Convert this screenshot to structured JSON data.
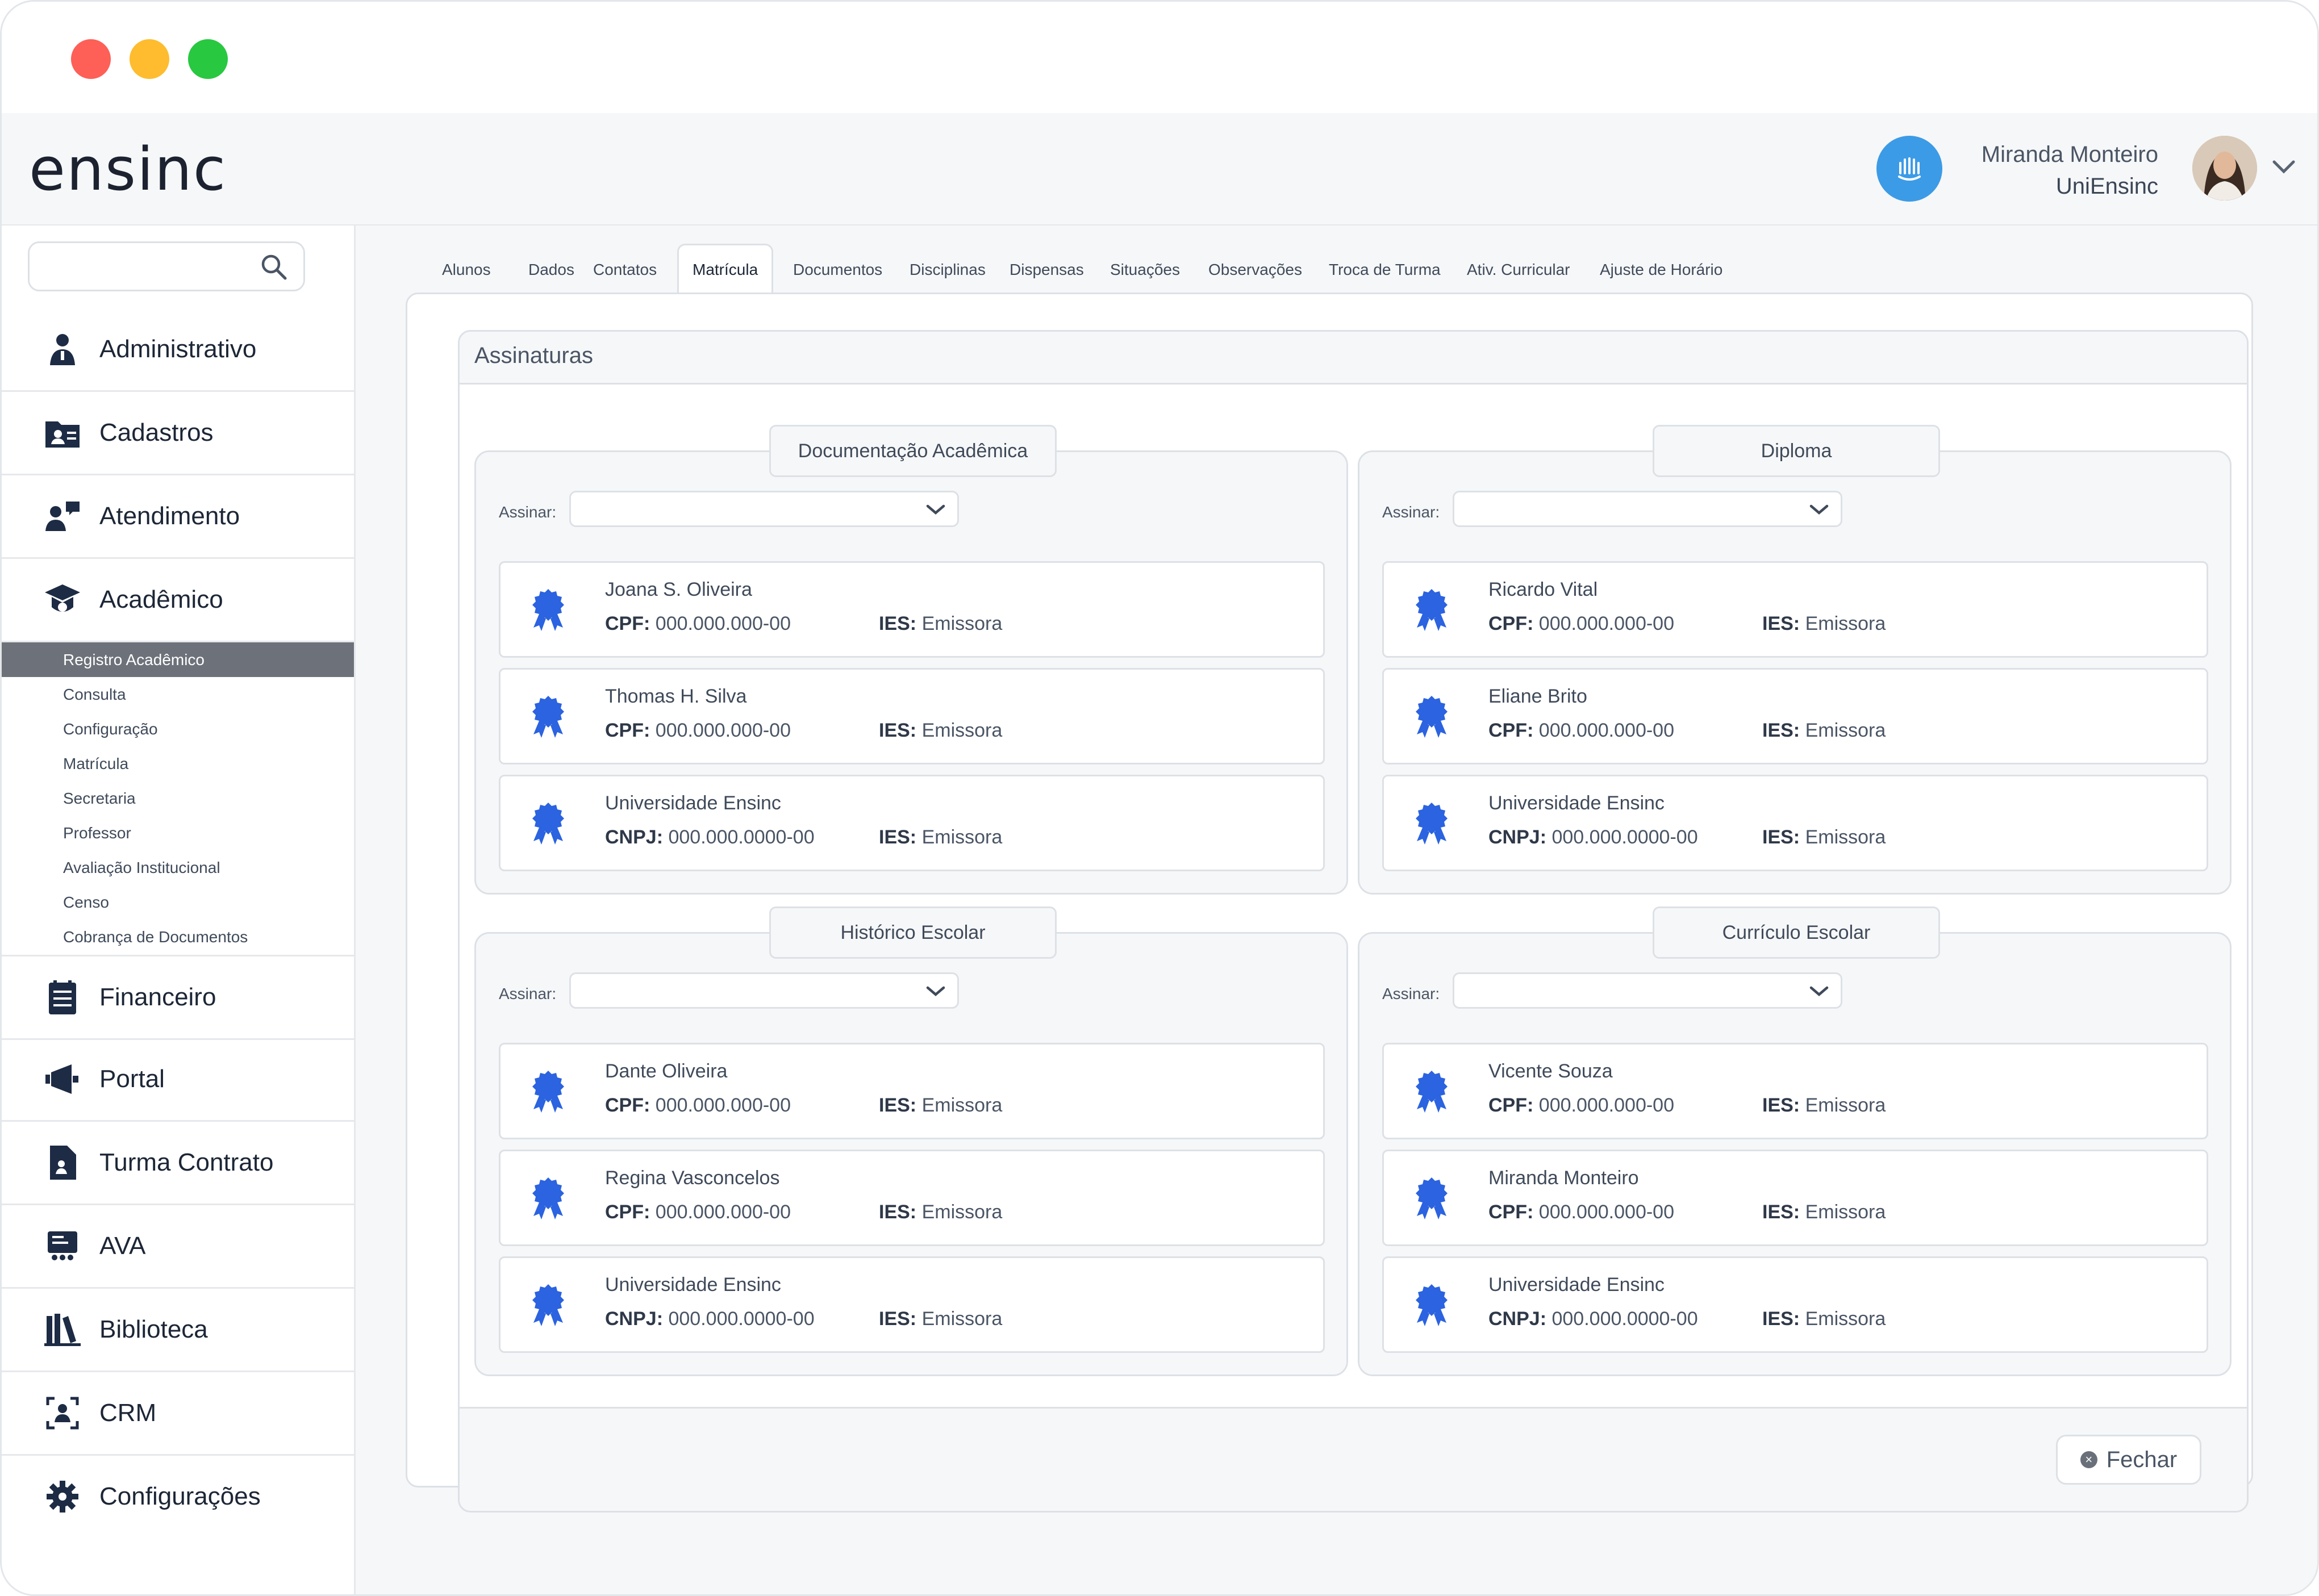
{
  "app": {
    "logo": "ensinc"
  },
  "user": {
    "name": "Miranda Monteiro",
    "org": "UniEnsinc"
  },
  "search": {
    "placeholder": ""
  },
  "sidebar": {
    "items": [
      {
        "label": "Administrativo",
        "icon": "person-badge-icon"
      },
      {
        "label": "Cadastros",
        "icon": "id-folder-icon"
      },
      {
        "label": "Atendimento",
        "icon": "people-chat-icon"
      },
      {
        "label": "Acadêmico",
        "icon": "graduation-cap-icon"
      },
      {
        "label": "Financeiro",
        "icon": "ledger-icon"
      },
      {
        "label": "Portal",
        "icon": "megaphone-icon"
      },
      {
        "label": "Turma Contrato",
        "icon": "contract-file-icon"
      },
      {
        "label": "AVA",
        "icon": "monitor-class-icon"
      },
      {
        "label": "Biblioteca",
        "icon": "books-icon"
      },
      {
        "label": "CRM",
        "icon": "crm-person-icon"
      },
      {
        "label": "Configurações",
        "icon": "gear-icon"
      }
    ],
    "submenu": [
      "Registro Acadêmico",
      "Consulta",
      "Configuração",
      "Matrícula",
      "Secretaria",
      "Professor",
      "Avaliação Institucional",
      "Censo",
      "Cobrança de Documentos"
    ]
  },
  "tabs": [
    "Alunos",
    "Dados",
    "Contatos",
    "Matrícula",
    "Documentos",
    "Disciplinas",
    "Dispensas",
    "Situações",
    "Observações",
    "Troca de Turma",
    "Ativ. Curricular",
    "Ajuste de Horário"
  ],
  "modal": {
    "title": "Assinaturas",
    "close_label": "Fechar",
    "assinar_label": "Assinar:",
    "labels": {
      "cpf": "CPF:",
      "cnpj": "CNPJ:",
      "ies": "IES:"
    },
    "groups": [
      {
        "title": "Documentação Acadêmica",
        "signers": [
          {
            "name": "Joana S. Oliveira",
            "doc_type": "CPF:",
            "doc": "000.000.000-00",
            "ies": "Emissora"
          },
          {
            "name": "Thomas H. Silva",
            "doc_type": "CPF:",
            "doc": "000.000.000-00",
            "ies": "Emissora"
          },
          {
            "name": "Universidade Ensinc",
            "doc_type": "CNPJ:",
            "doc": "000.000.0000-00",
            "ies": "Emissora"
          }
        ]
      },
      {
        "title": "Diploma",
        "signers": [
          {
            "name": "Ricardo Vital",
            "doc_type": "CPF:",
            "doc": "000.000.000-00",
            "ies": "Emissora"
          },
          {
            "name": "Eliane Brito",
            "doc_type": "CPF:",
            "doc": "000.000.000-00",
            "ies": "Emissora"
          },
          {
            "name": "Universidade Ensinc",
            "doc_type": "CNPJ:",
            "doc": "000.000.0000-00",
            "ies": "Emissora"
          }
        ]
      },
      {
        "title": "Histórico Escolar",
        "signers": [
          {
            "name": "Dante Oliveira",
            "doc_type": "CPF:",
            "doc": "000.000.000-00",
            "ies": "Emissora"
          },
          {
            "name": "Regina Vasconcelos",
            "doc_type": "CPF:",
            "doc": "000.000.000-00",
            "ies": "Emissora"
          },
          {
            "name": "Universidade Ensinc",
            "doc_type": "CNPJ:",
            "doc": "000.000.0000-00",
            "ies": "Emissora"
          }
        ]
      },
      {
        "title": "Currículo Escolar",
        "signers": [
          {
            "name": "Vicente Souza",
            "doc_type": "CPF:",
            "doc": "000.000.000-00",
            "ies": "Emissora"
          },
          {
            "name": "Miranda Monteiro",
            "doc_type": "CPF:",
            "doc": "000.000.000-00",
            "ies": "Emissora"
          },
          {
            "name": "Universidade Ensinc",
            "doc_type": "CNPJ:",
            "doc": "000.000.0000-00",
            "ies": "Emissora"
          }
        ]
      }
    ]
  },
  "colors": {
    "accent": "#3c9be6",
    "seal": "#2b63e0",
    "active_sub": "#6d717a"
  }
}
